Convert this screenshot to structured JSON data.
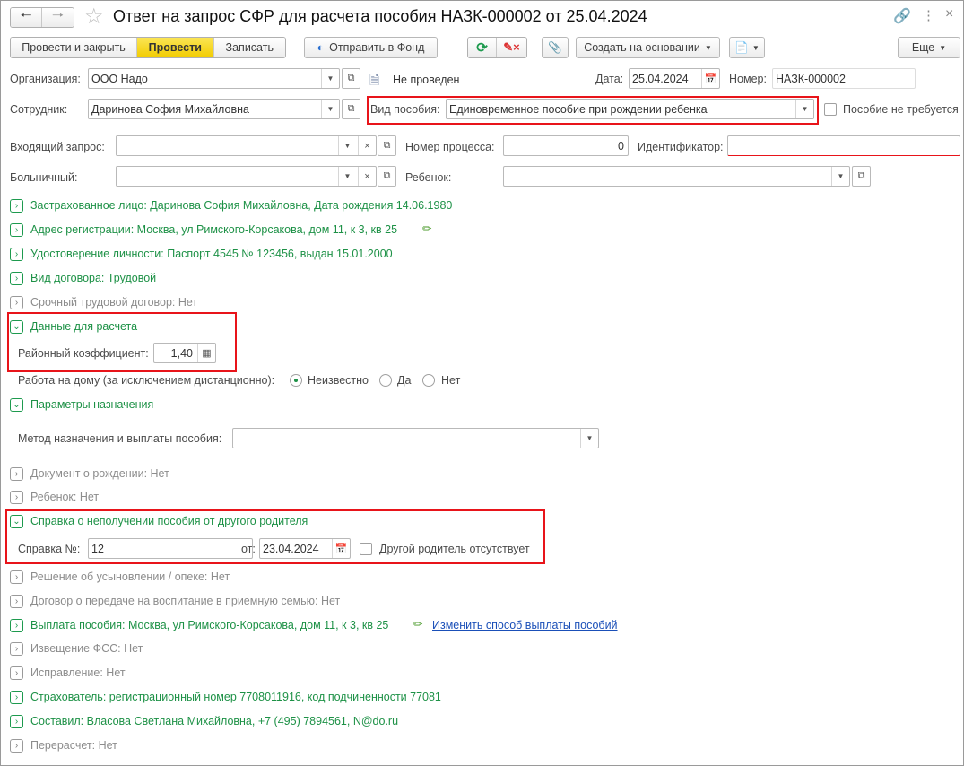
{
  "window": {
    "title": "Ответ на запрос СФР для расчета пособия НАЗК-000002 от 25.04.2024"
  },
  "toolbar": {
    "post_close": "Провести и закрыть",
    "post": "Провести",
    "save": "Записать",
    "send": "Отправить в Фонд",
    "create_based": "Создать на основании",
    "more": "Еще",
    "accent": "#f2cc00"
  },
  "header": {
    "org_label": "Организация:",
    "org_value": "ООО Надо",
    "status": "Не проведен",
    "date_label": "Дата:",
    "date_value": "25.04.2024",
    "number_label": "Номер:",
    "number_value": "НАЗК-000002",
    "employee_label": "Сотрудник:",
    "employee_value": "Даринова София Михайловна",
    "benefit_label": "Вид пособия:",
    "benefit_value": "Единовременное пособие при рождении ребенка",
    "not_required_label": "Пособие не требуется",
    "request_label": "Входящий запрос:",
    "request_value": "",
    "process_label": "Номер процесса:",
    "process_value": "0",
    "id_label": "Идентификатор:",
    "id_value": "",
    "sick_label": "Больничный:",
    "sick_value": "",
    "child_label": "Ребенок:",
    "child_value": ""
  },
  "sections": {
    "insured": "Застрахованное лицо: Даринова София Михайловна, Дата рождения 14.06.1980",
    "address": "Адрес регистрации: Москва, ул Римского-Корсакова, дом 11, к 3, кв 25",
    "identity": "Удостоверение личности: Паспорт 4545 № 123456, выдан 15.01.2000",
    "contract": "Вид договора: Трудовой",
    "fixed_term": "Срочный трудовой договор: Нет",
    "calc_data": "Данные для расчета",
    "district_coef_label": "Районный коэффициент:",
    "district_coef_value": "1,40",
    "home_work_label": "Работа на дому (за исключением дистанционно):",
    "home_work_options": [
      "Неизвестно",
      "Да",
      "Нет"
    ],
    "home_work_selected": "Неизвестно",
    "assignment": "Параметры назначения",
    "method_label": "Метод назначения и выплаты пособия:",
    "method_value": "",
    "birth_doc": "Документ о рождении: Нет",
    "child": "Ребенок: Нет",
    "certificate": "Справка о неполучении пособия от другого родителя",
    "cert_no_label": "Справка №:",
    "cert_no_value": "12",
    "cert_date_label": "от:",
    "cert_date_value": "23.04.2024",
    "other_parent_absent": "Другой родитель отсутствует",
    "adoption": "Решение об усыновлении / опеке: Нет",
    "foster": "Договор о передаче на воспитание в приемную семью: Нет",
    "payment": "Выплата пособия: Москва, ул Римского-Корсакова, дом 11, к 3, кв 25",
    "payment_link": "Изменить способ выплаты пособий",
    "fss_notice": "Извещение ФСС: Нет",
    "correction": "Исправление: Нет",
    "insurer": "Страхователь: регистрационный номер 7708011916, код подчиненности 77081",
    "author": "Составил: Власова Светлана Михайловна, +7 (495) 7894561, N@do.ru",
    "recalc": "Перерасчет: Нет"
  }
}
